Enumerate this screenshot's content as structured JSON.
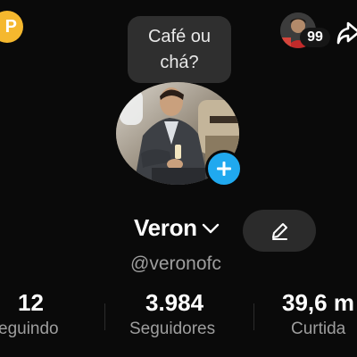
{
  "header": {
    "coin_badge_label": "P",
    "notification_count": "99"
  },
  "profile": {
    "note_line1": "Café ou",
    "note_line2": "chá?",
    "display_name": "Veron",
    "username": "@veronofc"
  },
  "stats": {
    "following_value": "12",
    "following_label": "eguindo",
    "followers_value": "3.984",
    "followers_label": "Seguidores",
    "likes_value": "39,6 m",
    "likes_label": "Curtida"
  },
  "icons": {
    "coin": "coin-icon",
    "add_story": "plus-icon",
    "share": "share-arrow-icon",
    "chevron": "chevron-down-icon",
    "edit": "pencil-icon"
  },
  "colors": {
    "background": "#0a0a0a",
    "coin": "#f5b82e",
    "add_story": "#20a9ef",
    "secondary_text": "#9e9e9e",
    "note_bubble": "#2f2f2f",
    "edit_button": "#2b2b2b"
  }
}
